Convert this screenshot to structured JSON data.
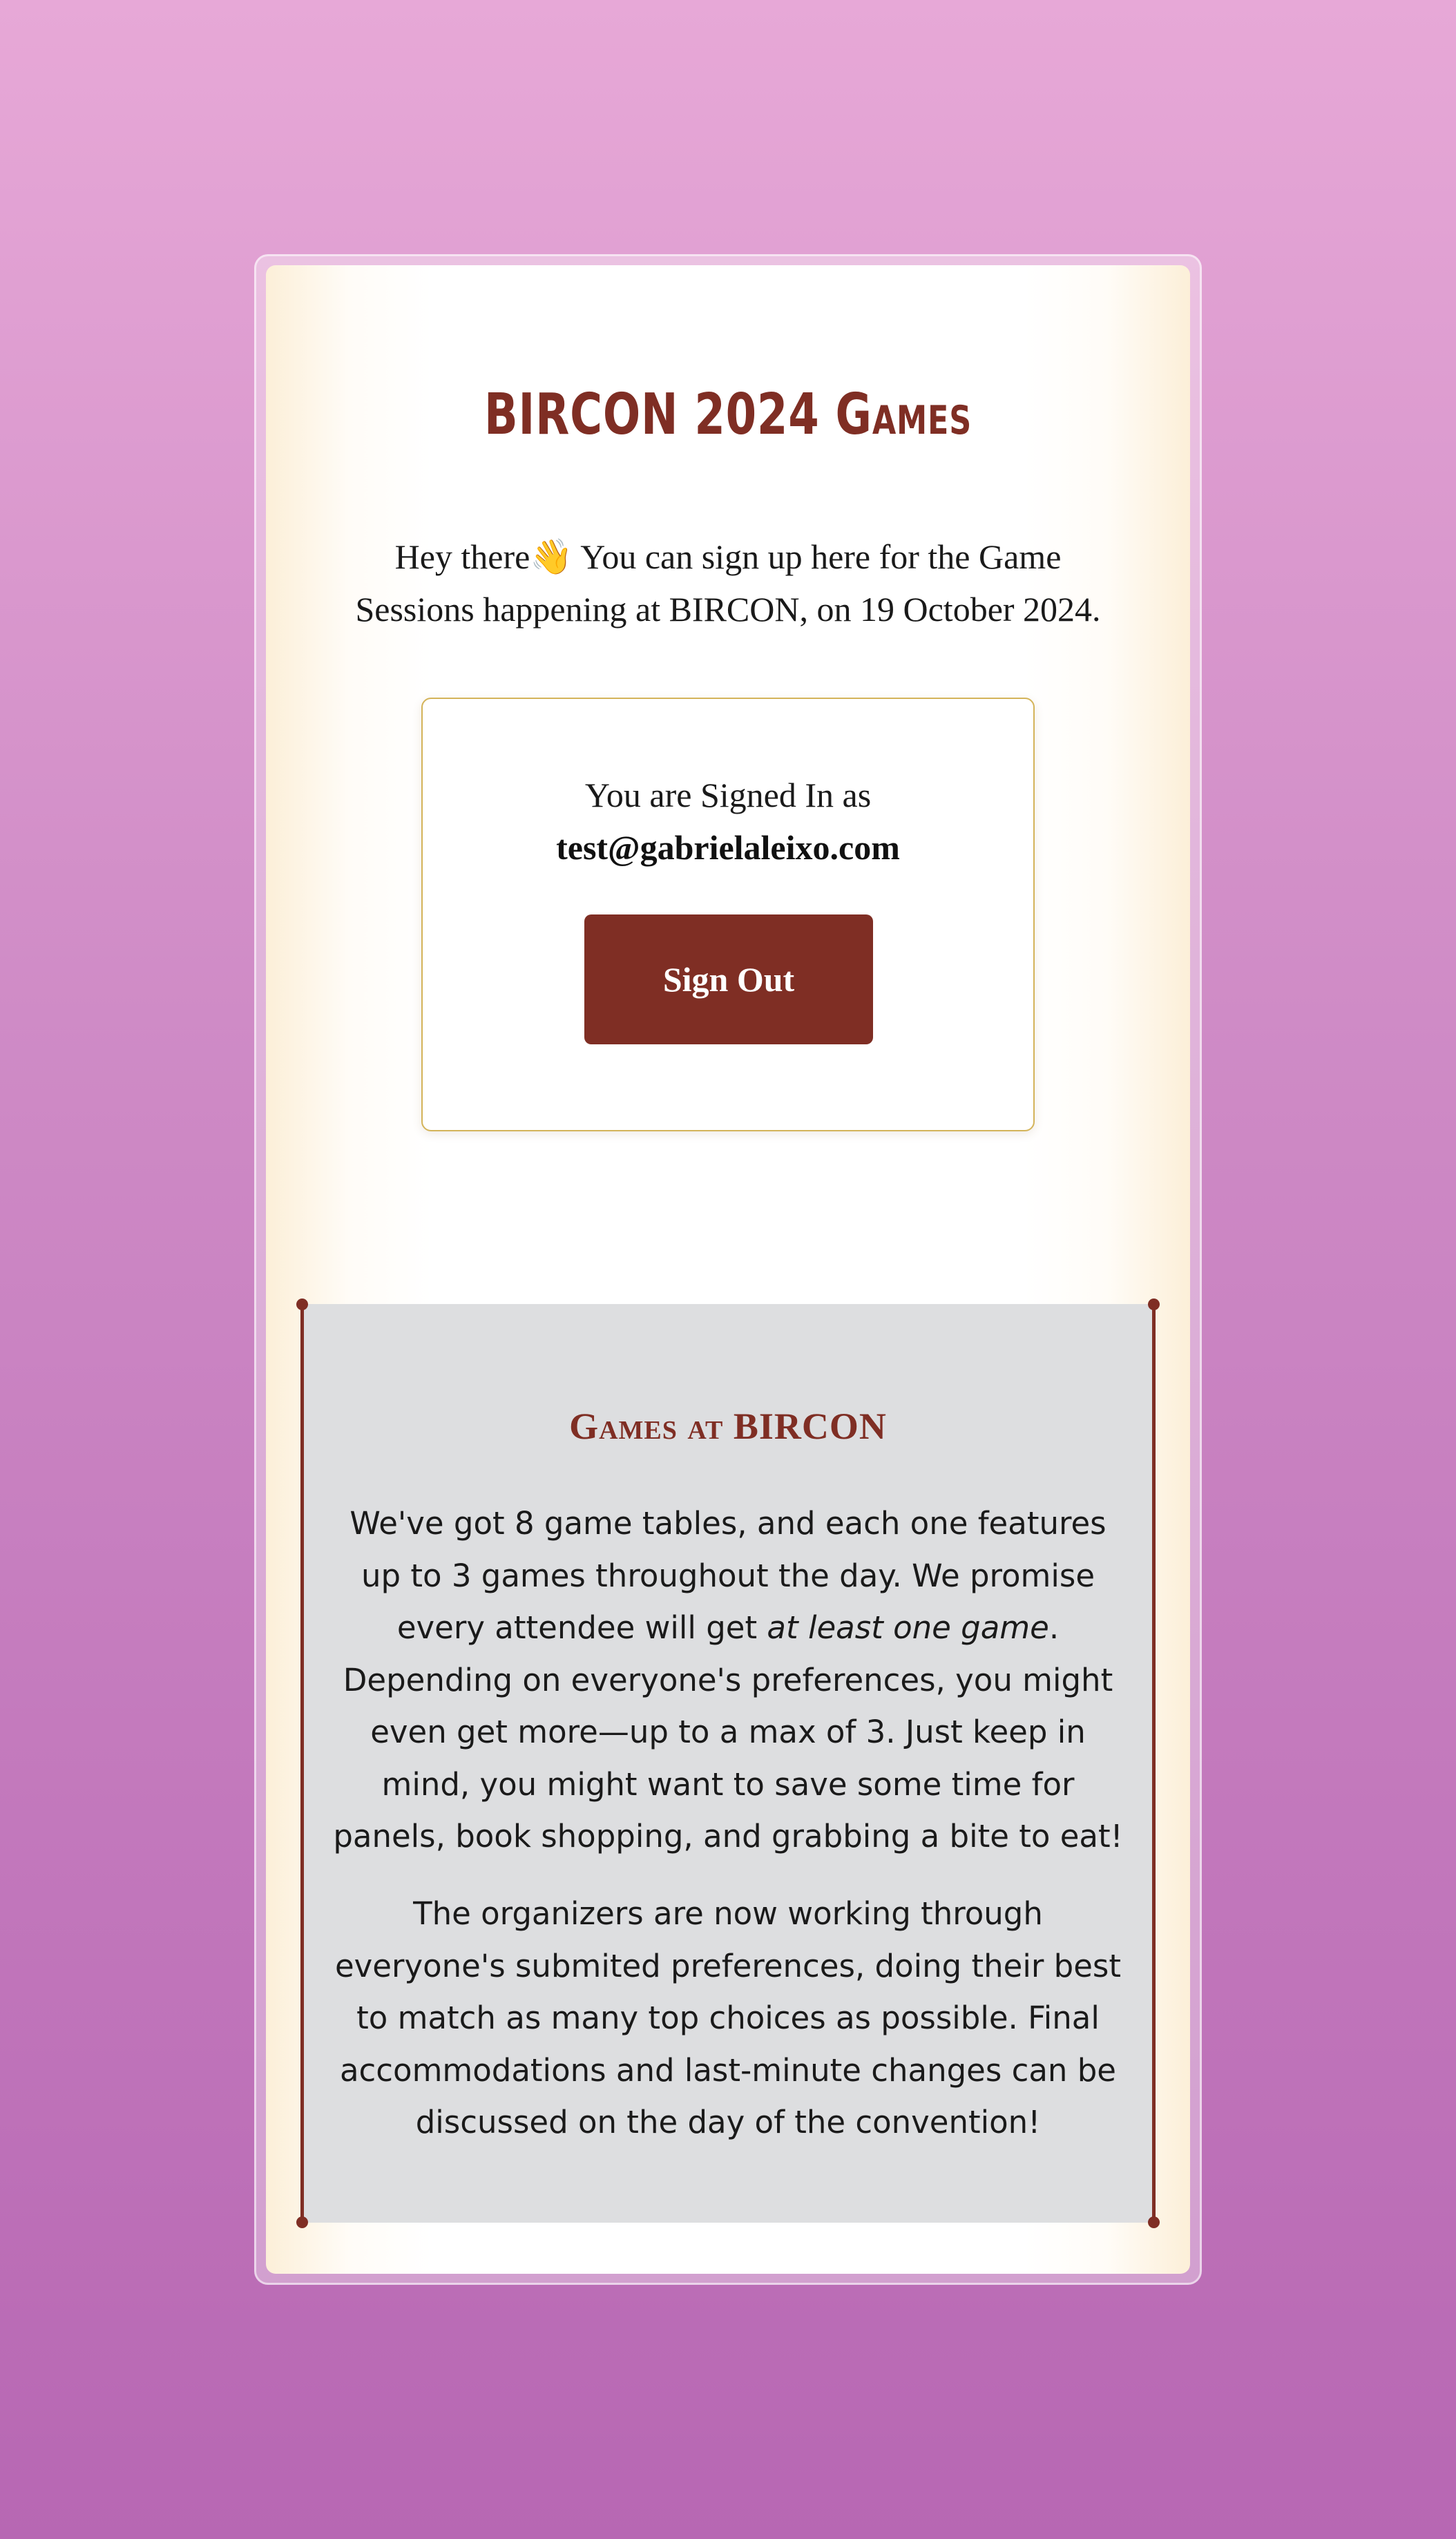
{
  "header": {
    "title_main": "BIRCON 2024",
    "title_sc": "Games"
  },
  "intro": {
    "greeting": "Hey there",
    "wave_emoji": "👋",
    "line1_rest": " You can sign up here for the Game",
    "line2": "Sessions happening at BIRCON, on 19 October 2024."
  },
  "signin": {
    "status_label": "You are Signed In as",
    "email": "test@gabrielaleixo.com",
    "signout_label": "Sign Out"
  },
  "games_info": {
    "title": "Games at BIRCON",
    "p1_before": "We've got 8 game tables, and each one features up to 3 games throughout the day. We promise every attendee will get ",
    "p1_emphasis": "at least one game",
    "p1_after": ". Depending on everyone's preferences, you might even get more—up to a max of 3. Just keep in mind, you might want to save some time for panels, book shopping, and grabbing a bite to eat!",
    "p2": "The organizers are now working through everyone's submited preferences, doing their best to match as many top choices as possible. Final accommodations and last-minute changes can be discussed on the day of the convention!"
  },
  "colors": {
    "accent": "#7f2e24",
    "box_border": "#d4b45a",
    "panel_bg": "#dddee0",
    "page_bg_top": "#e7a8d7",
    "page_bg_bottom": "#b767b3"
  }
}
